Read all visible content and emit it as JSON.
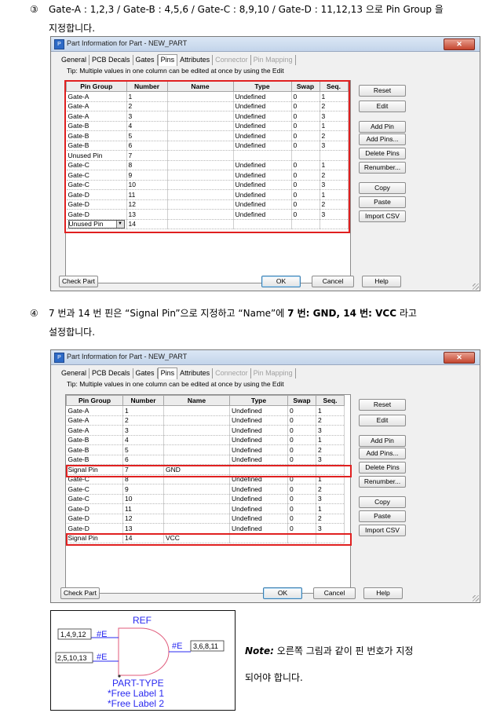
{
  "step3": {
    "number": "③",
    "text_line1": "Gate-A : 1,2,3 / Gate-B : 4,5,6 / Gate-C : 8,9,10 / Gate-D : 11,12,13 으로 Pin Group 을",
    "text_line2": "지정합니다."
  },
  "step4": {
    "number": "④",
    "text_a": "7 번과 14 번 핀은 “Signal Pin”으로 지정하고 “Name”에 ",
    "text_bold": "7 번: GND, 14 번: VCC",
    "text_b": " 라고",
    "text_line2": "설정합니다."
  },
  "dialog": {
    "title": "Part Information for Part - NEW_PART",
    "close": "✕",
    "app_icon": "P",
    "tabs": [
      {
        "label": "General",
        "state": "normal"
      },
      {
        "label": "PCB Decals",
        "state": "normal"
      },
      {
        "label": "Gates",
        "state": "normal"
      },
      {
        "label": "Pins",
        "state": "active"
      },
      {
        "label": "Attributes",
        "state": "normal"
      },
      {
        "label": "Connector",
        "state": "disabled"
      },
      {
        "label": "Pin Mapping",
        "state": "disabled"
      }
    ],
    "tip": "Tip: Multiple values in one column can be edited at once by using the Edit",
    "columns": [
      "Pin Group",
      "Number",
      "Name",
      "Type",
      "Swap",
      "Seq."
    ],
    "side_buttons": [
      "Reset",
      "Edit",
      "Add Pin",
      "Add Pins...",
      "Delete Pins",
      "Renumber...",
      "Copy",
      "Paste",
      "Import CSV"
    ],
    "check_part": "Check Part",
    "ok": "OK",
    "cancel": "Cancel",
    "help": "Help"
  },
  "dialog1_rows": [
    [
      "Gate-A",
      "1",
      "",
      "Undefined",
      "0",
      "1"
    ],
    [
      "Gate-A",
      "2",
      "",
      "Undefined",
      "0",
      "2"
    ],
    [
      "Gate-A",
      "3",
      "",
      "Undefined",
      "0",
      "3"
    ],
    [
      "Gate-B",
      "4",
      "",
      "Undefined",
      "0",
      "1"
    ],
    [
      "Gate-B",
      "5",
      "",
      "Undefined",
      "0",
      "2"
    ],
    [
      "Gate-B",
      "6",
      "",
      "Undefined",
      "0",
      "3"
    ],
    [
      "Unused Pin",
      "7",
      "",
      "",
      "",
      ""
    ],
    [
      "Gate-C",
      "8",
      "",
      "Undefined",
      "0",
      "1"
    ],
    [
      "Gate-C",
      "9",
      "",
      "Undefined",
      "0",
      "2"
    ],
    [
      "Gate-C",
      "10",
      "",
      "Undefined",
      "0",
      "3"
    ],
    [
      "Gate-D",
      "11",
      "",
      "Undefined",
      "0",
      "1"
    ],
    [
      "Gate-D",
      "12",
      "",
      "Undefined",
      "0",
      "2"
    ],
    [
      "Gate-D",
      "13",
      "",
      "Undefined",
      "0",
      "3"
    ],
    [
      "Unused Pin",
      "14",
      "",
      "",
      "",
      ""
    ]
  ],
  "dialog2_rows": [
    [
      "Gate-A",
      "1",
      "",
      "Undefined",
      "0",
      "1"
    ],
    [
      "Gate-A",
      "2",
      "",
      "Undefined",
      "0",
      "2"
    ],
    [
      "Gate-A",
      "3",
      "",
      "Undefined",
      "0",
      "3"
    ],
    [
      "Gate-B",
      "4",
      "",
      "Undefined",
      "0",
      "1"
    ],
    [
      "Gate-B",
      "5",
      "",
      "Undefined",
      "0",
      "2"
    ],
    [
      "Gate-B",
      "6",
      "",
      "Undefined",
      "0",
      "3"
    ],
    [
      "Signal Pin",
      "7",
      "GND",
      "",
      "",
      ""
    ],
    [
      "Gate-C",
      "8",
      "",
      "Undefined",
      "0",
      "1"
    ],
    [
      "Gate-C",
      "9",
      "",
      "Undefined",
      "0",
      "2"
    ],
    [
      "Gate-C",
      "10",
      "",
      "Undefined",
      "0",
      "3"
    ],
    [
      "Gate-D",
      "11",
      "",
      "Undefined",
      "0",
      "1"
    ],
    [
      "Gate-D",
      "12",
      "",
      "Undefined",
      "0",
      "2"
    ],
    [
      "Gate-D",
      "13",
      "",
      "Undefined",
      "0",
      "3"
    ],
    [
      "Signal Pin",
      "14",
      "VCC",
      "",
      "",
      ""
    ]
  ],
  "symbol": {
    "ref": "REF",
    "pin_left_top": "1,4,9,12",
    "pin_left_bottom": "2,5,10,13",
    "pin_right": "3,6,8,11",
    "label_e": "#E",
    "part_type": "PART-TYPE",
    "free_label1": "*Free Label 1",
    "free_label2": "*Free Label 2"
  },
  "note": {
    "label": "Note:",
    "line1": "오른쪽 그림과 같이 핀 번호가 지정",
    "line2": "되어야 합니다."
  },
  "colors": {
    "highlight": "#e02020",
    "symbol_blue": "#2a2af0",
    "gate_outline": "#e05a7a"
  }
}
